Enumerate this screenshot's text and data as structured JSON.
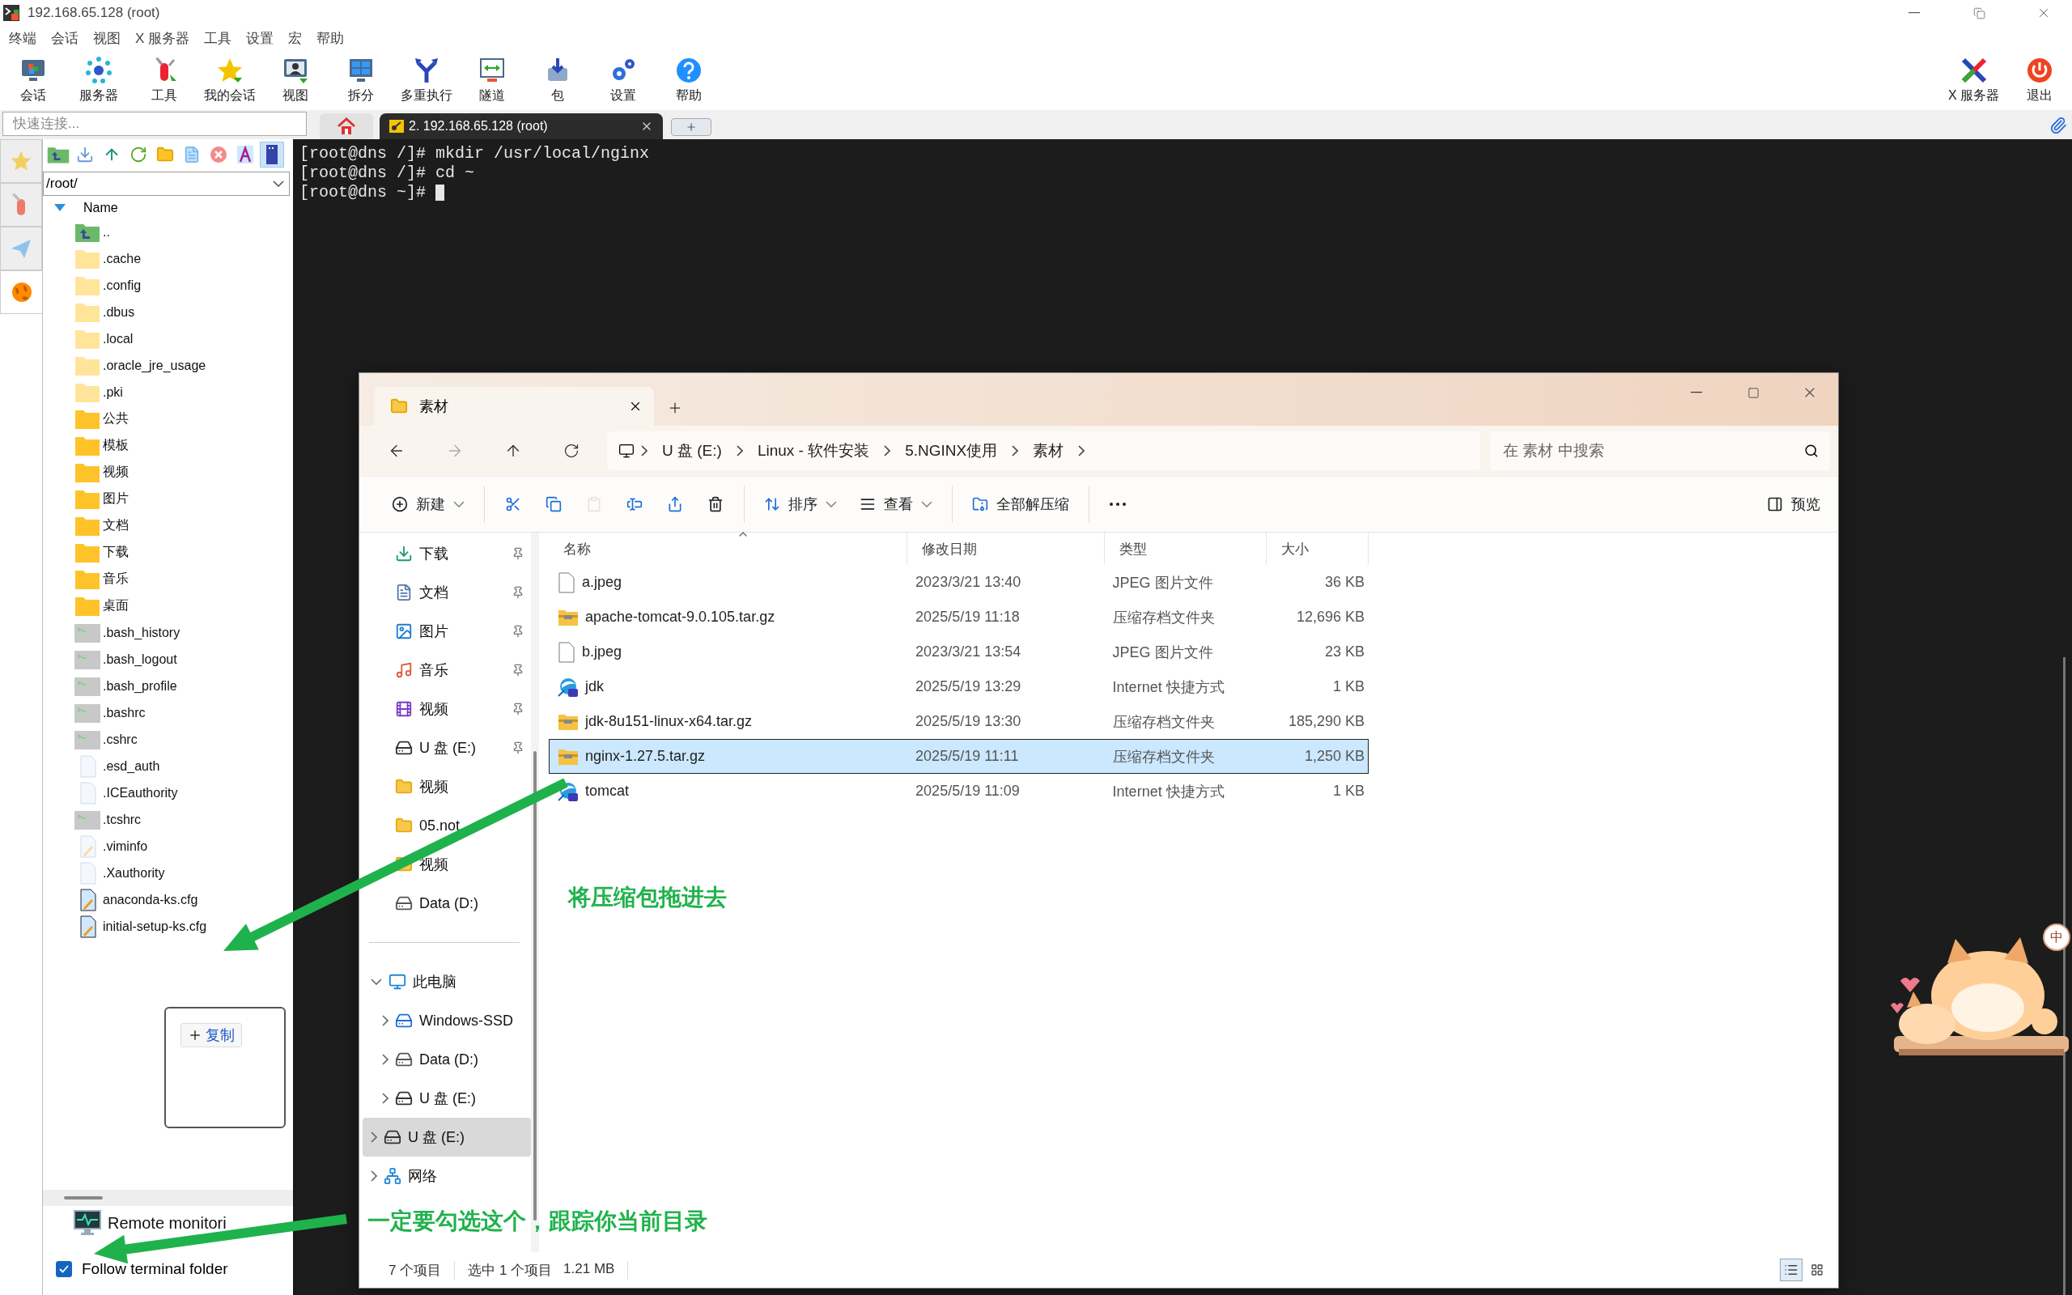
{
  "window": {
    "title": "192.168.65.128  (root)"
  },
  "menu": [
    "终端",
    "会话",
    "视图",
    "X 服务器",
    "工具",
    "设置",
    "宏",
    "帮助"
  ],
  "toolbar": [
    "会话",
    "服务器",
    "工具",
    "我的会话",
    "视图",
    "拆分",
    "多重执行",
    "隧道",
    "包",
    "设置",
    "帮助"
  ],
  "toolbar_right": [
    "X 服务器",
    "退出"
  ],
  "quick_connect": {
    "placeholder": "快速连接..."
  },
  "tabs": [
    {
      "label": "2. 192.168.65.128  (root)",
      "selected": true
    }
  ],
  "side_tabs": [
    {
      "selected": false
    },
    {
      "selected": false
    },
    {
      "selected": false
    },
    {
      "selected": true
    }
  ],
  "sftp": {
    "split_toggle": {
      "on": true
    },
    "path": "/root/",
    "header": "Name",
    "items": [
      {
        "name": "..",
        "kind": "up"
      },
      {
        "name": ".cache",
        "kind": "hidden_folder"
      },
      {
        "name": ".config",
        "kind": "hidden_folder"
      },
      {
        "name": ".dbus",
        "kind": "hidden_folder"
      },
      {
        "name": ".local",
        "kind": "hidden_folder"
      },
      {
        "name": ".oracle_jre_usage",
        "kind": "hidden_folder"
      },
      {
        "name": ".pki",
        "kind": "hidden_folder"
      },
      {
        "name": "公共",
        "kind": "folder"
      },
      {
        "name": "模板",
        "kind": "folder"
      },
      {
        "name": "视频",
        "kind": "folder"
      },
      {
        "name": "图片",
        "kind": "folder"
      },
      {
        "name": "文档",
        "kind": "folder"
      },
      {
        "name": "下载",
        "kind": "folder"
      },
      {
        "name": "音乐",
        "kind": "folder"
      },
      {
        "name": "桌面",
        "kind": "folder"
      },
      {
        "name": ".bash_history",
        "kind": "script"
      },
      {
        "name": ".bash_logout",
        "kind": "script"
      },
      {
        "name": ".bash_profile",
        "kind": "script"
      },
      {
        "name": ".bashrc",
        "kind": "script"
      },
      {
        "name": ".cshrc",
        "kind": "script"
      },
      {
        "name": ".esd_auth",
        "kind": "file"
      },
      {
        "name": ".ICEauthority",
        "kind": "file"
      },
      {
        "name": ".tcshrc",
        "kind": "script"
      },
      {
        "name": ".viminfo",
        "kind": "text"
      },
      {
        "name": ".Xauthority",
        "kind": "file"
      },
      {
        "name": "anaconda-ks.cfg",
        "kind": "cfg"
      },
      {
        "name": "initial-setup-ks.cfg",
        "kind": "cfg"
      }
    ],
    "copy_popup": {
      "button": "复制"
    },
    "remote_monitoring": "Remote monitori",
    "follow": {
      "label": "Follow terminal folder",
      "checked": true
    }
  },
  "terminal": {
    "lines": [
      "[root@dns /]# mkdir /usr/local/nginx",
      "[root@dns /]# cd ~",
      "[root@dns ~]# "
    ],
    "cursor": true
  },
  "explorer": {
    "tab": {
      "title": "素材"
    },
    "breadcrumb": [
      "U 盘 (E:)",
      "Linux - 软件安装",
      "5.NGINX使用",
      "素材"
    ],
    "search": {
      "placeholder": "在 素材 中搜索"
    },
    "command_groups": [
      [
        {
          "kind": "new",
          "label": "新建",
          "dropdown": true,
          "disabled": false
        }
      ],
      [
        {
          "kind": "cut",
          "dropdown": false,
          "disabled": false
        },
        {
          "kind": "copy",
          "dropdown": false,
          "disabled": false
        },
        {
          "kind": "paste",
          "dropdown": false,
          "disabled": true
        },
        {
          "kind": "rename",
          "dropdown": false,
          "disabled": false
        },
        {
          "kind": "share",
          "dropdown": false,
          "disabled": false
        },
        {
          "kind": "delete",
          "dropdown": false,
          "disabled": false
        }
      ],
      [
        {
          "kind": "sort",
          "label": "排序",
          "dropdown": true,
          "disabled": false
        },
        {
          "kind": "view",
          "label": "查看",
          "dropdown": true,
          "disabled": false
        }
      ],
      [
        {
          "kind": "extract",
          "label": "全部解压缩",
          "dropdown": false,
          "disabled": false
        }
      ],
      [
        {
          "kind": "more",
          "dropdown": false,
          "disabled": false
        }
      ]
    ],
    "preview": "预览",
    "quick_access": [
      {
        "label": "下载",
        "kind": "download",
        "pinned": true
      },
      {
        "label": "文档",
        "kind": "documents",
        "pinned": true
      },
      {
        "label": "图片",
        "kind": "pictures",
        "pinned": true
      },
      {
        "label": "音乐",
        "kind": "music",
        "pinned": true
      },
      {
        "label": "视频",
        "kind": "videos",
        "pinned": true
      },
      {
        "label": "U 盘 (E:)",
        "kind": "drive",
        "pinned": true
      },
      {
        "label": "视频",
        "kind": "folder",
        "pinned": false
      },
      {
        "label": "05.not",
        "kind": "folder",
        "pinned": false
      },
      {
        "label": "视频",
        "kind": "folder",
        "pinned": false
      },
      {
        "label": "Data (D:)",
        "kind": "netdrive",
        "pinned": false
      }
    ],
    "tree": [
      {
        "label": "此电脑",
        "kind": "pc",
        "expanded": true,
        "selected": false,
        "children": [
          {
            "label": "Windows-SSD",
            "kind": "windrive",
            "expanded": false,
            "selected": false
          },
          {
            "label": "Data (D:)",
            "kind": "netdrive",
            "expanded": false,
            "selected": false
          },
          {
            "label": "U 盘 (E:)",
            "kind": "drive",
            "expanded": false,
            "selected": false
          }
        ]
      },
      {
        "label": "U 盘 (E:)",
        "kind": "drive",
        "expanded": false,
        "selected": true
      },
      {
        "label": "网络",
        "kind": "network",
        "expanded": false,
        "selected": false
      }
    ],
    "columns": [
      "名称",
      "修改日期",
      "类型",
      "大小"
    ],
    "rows": [
      {
        "name": "a.jpeg",
        "kind": "file",
        "date": "2023/3/21 13:40",
        "type": "JPEG 图片文件",
        "size": "36 KB",
        "selected": false
      },
      {
        "name": "apache-tomcat-9.0.105.tar.gz",
        "kind": "archive",
        "date": "2025/5/19 11:18",
        "type": "压缩存档文件夹",
        "size": "12,696 KB",
        "selected": false
      },
      {
        "name": "b.jpeg",
        "kind": "file",
        "date": "2023/3/21 13:54",
        "type": "JPEG 图片文件",
        "size": "23 KB",
        "selected": false
      },
      {
        "name": "jdk",
        "kind": "shortcut",
        "date": "2025/5/19 13:29",
        "type": "Internet 快捷方式",
        "size": "1 KB",
        "selected": false
      },
      {
        "name": "jdk-8u151-linux-x64.tar.gz",
        "kind": "archive",
        "date": "2025/5/19 13:30",
        "type": "压缩存档文件夹",
        "size": "185,290 KB",
        "selected": false
      },
      {
        "name": "nginx-1.27.5.tar.gz",
        "kind": "archive",
        "date": "2025/5/19 11:11",
        "type": "压缩存档文件夹",
        "size": "1,250 KB",
        "selected": true
      },
      {
        "name": "tomcat",
        "kind": "shortcut",
        "date": "2025/5/19 11:09",
        "type": "Internet 快捷方式",
        "size": "1 KB",
        "selected": false
      }
    ],
    "status": [
      [
        "7 个项目"
      ],
      [
        "选中 1 个项目",
        "1.21 MB"
      ]
    ],
    "view_buttons": [
      {
        "selected": true
      },
      {
        "selected": false
      }
    ]
  },
  "annotations": [
    "将压缩包拖进去",
    "一定要勾选这个，跟踪你当前目录"
  ],
  "ime": "中"
}
